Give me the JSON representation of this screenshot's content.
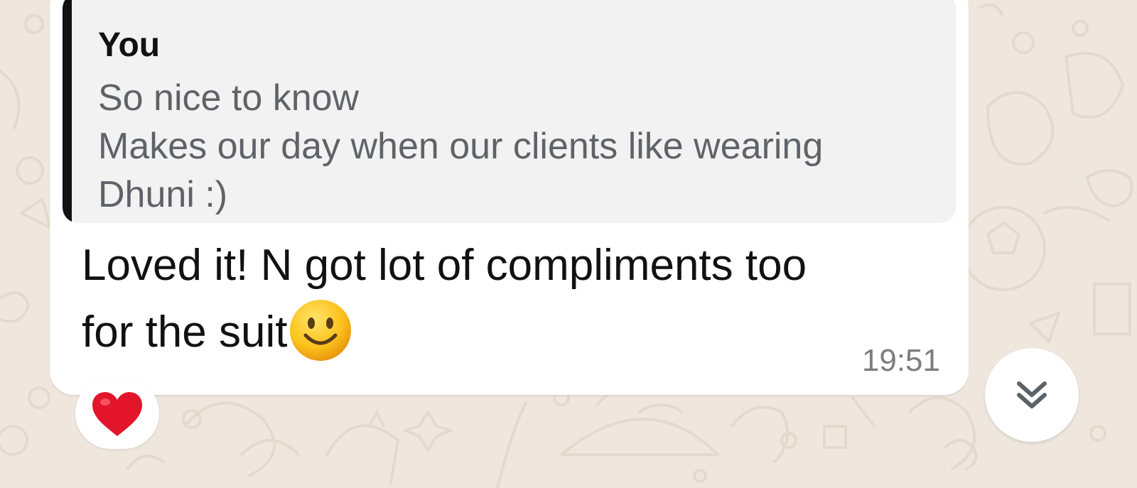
{
  "quoted_message": {
    "author": "You",
    "lines": [
      "So nice to know",
      "Makes our day when our clients like wearing",
      "Dhuni :)"
    ]
  },
  "message": {
    "lines": [
      "Loved it! N got lot of compliments too",
      "for the suit"
    ],
    "trailing_emoji": "smiling-face-emoji",
    "time": "19:51"
  },
  "reaction": {
    "icon": "red-heart-icon"
  },
  "scroll_button": {
    "icon": "double-chevron-down-icon"
  },
  "colors": {
    "wallpaper": "#efe7de",
    "wallpaper_doodle": "#e4d9cc",
    "bubble": "#ffffff",
    "quote_background": "#f2f2f2",
    "quote_bar": "#111111",
    "heart": "#e3152b"
  }
}
